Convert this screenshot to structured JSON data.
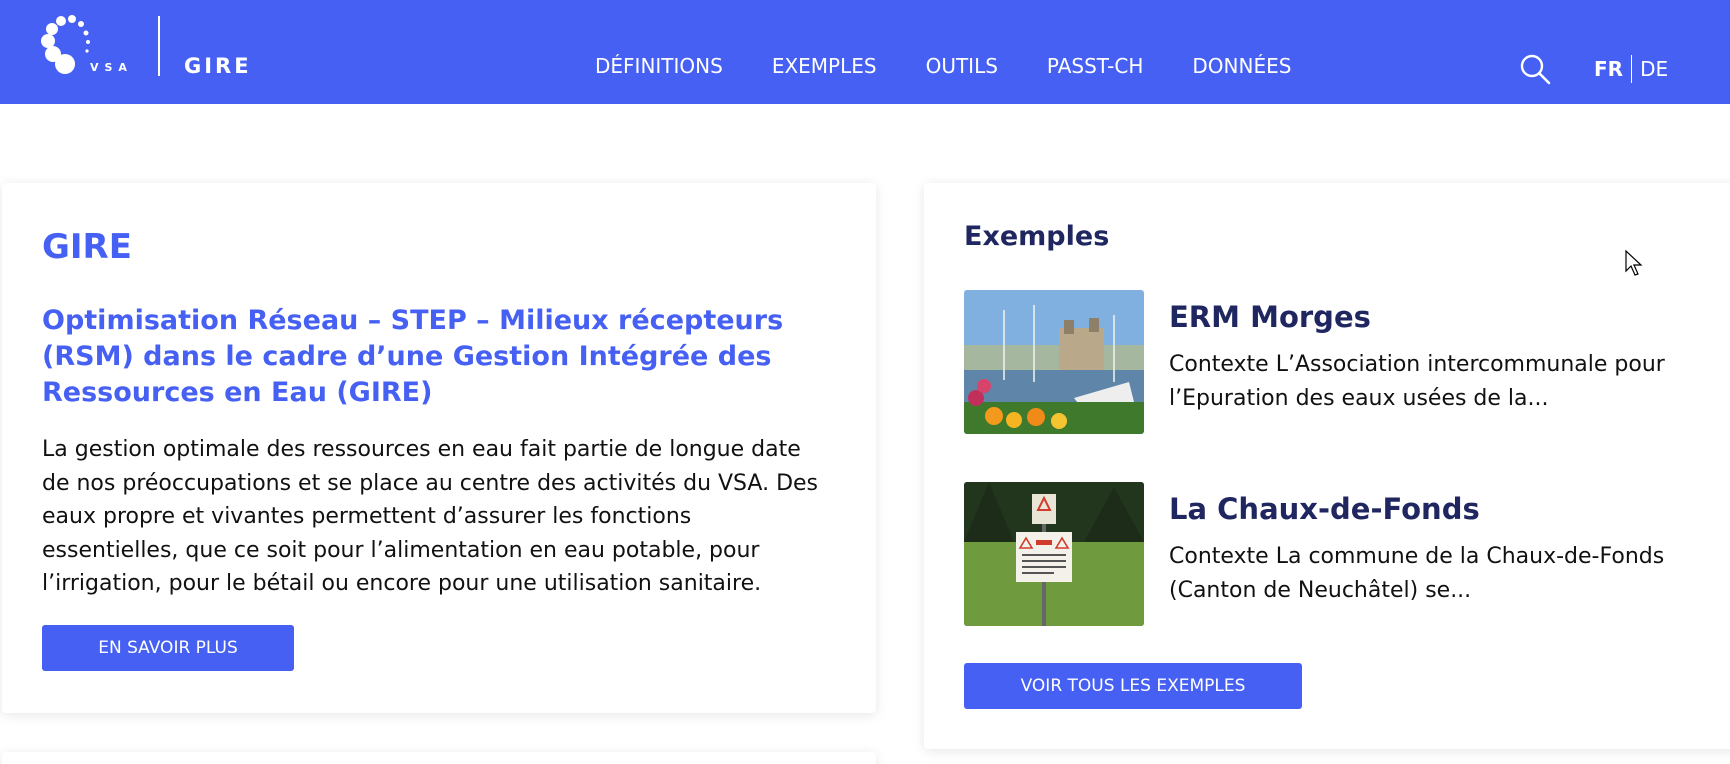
{
  "header": {
    "logo_text": "VSA",
    "site_name": "GIRE",
    "nav": [
      {
        "label": "DÉFINITIONS"
      },
      {
        "label": "EXEMPLES"
      },
      {
        "label": "OUTILS"
      },
      {
        "label": "PASST-CH"
      },
      {
        "label": "DONNÉES"
      }
    ],
    "search_icon": "search-icon",
    "lang": {
      "active": "FR",
      "other": "DE"
    },
    "colors": {
      "brand": "#4660f3"
    }
  },
  "intro": {
    "heading": "GIRE",
    "subtitle": "Optimisation Réseau – STEP – Milieux récepteurs (RSM) dans le cadre d’une Gestion Intégrée des Ressources en Eau (GIRE)",
    "body": "La gestion optimale des ressources en eau fait partie de longue date de nos préoccupations et se place au centre des activités du VSA. Des eaux propre et vivantes permettent d’assurer les fonctions essentielles, que ce soit pour l’alimentation en eau potable, pour l’irrigation, pour le bétail ou encore pour une utilisation sanitaire.",
    "button_label": "EN SAVOIR PLUS"
  },
  "examples": {
    "heading": "Exemples",
    "items": [
      {
        "title": "ERM Morges",
        "excerpt": "Contexte L’Association intercommunale pour l’Epuration des eaux usées de la...",
        "image": "harbor-photo"
      },
      {
        "title": "La Chaux-de-Fonds",
        "excerpt": "Contexte La commune de la Chaux-de-Fonds (Canton de Neuchâtel) se...",
        "image": "sign-photo"
      }
    ],
    "button_label": "VOIR TOUS LES EXEMPLES"
  },
  "text_color": "#1f2660"
}
